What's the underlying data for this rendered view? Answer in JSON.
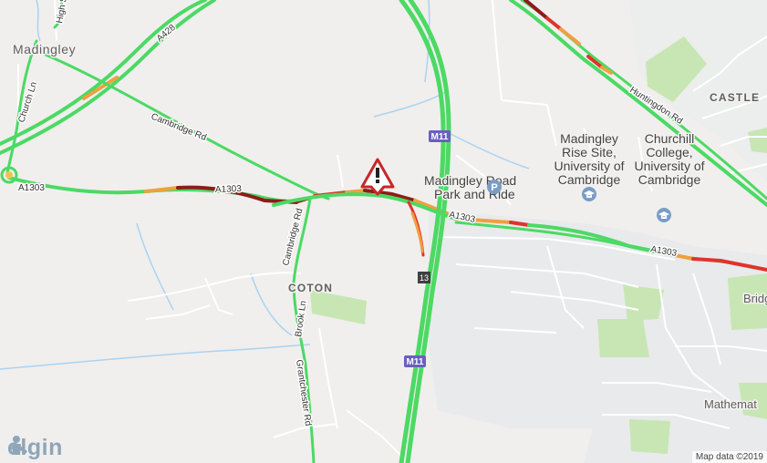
{
  "map": {
    "roads": {
      "m11_top": "M11",
      "m11_bottom": "M11",
      "junction": "13",
      "a1303_left": "A1303",
      "a1303_mid": "A1303",
      "a1303_right_1": "A1303",
      "a1303_right_2": "A1303",
      "a428": "A428",
      "cambridge_rd_1": "Cambridge Rd",
      "cambridge_rd_2": "Cambridge Rd",
      "huntingdon_rd": "Huntingdon Rd",
      "church_ln": "Church Ln",
      "high_st": "High St",
      "brook_ln": "Brook Ln",
      "grantchester_rd": "Grantchester Rd"
    },
    "places": {
      "madingley": "Madingley",
      "coton": "COTON",
      "castle": "CASTLE",
      "bridge_partial": "Bridg",
      "mathematics_partial": "Mathemat"
    },
    "pois": {
      "park_and_ride": [
        "Madingley Road",
        "Park and Ride"
      ],
      "madingley_rise": [
        "Madingley",
        "Rise Site,",
        "University of",
        "Cambridge"
      ],
      "churchill": [
        "Churchill",
        "College,",
        "University of",
        "Cambridge"
      ]
    },
    "attribution": "Map data ©2019",
    "brand": "elgin",
    "traffic_colors": {
      "free_flow": "#4cd964",
      "slow": "#f0a040",
      "congested": "#e0332b",
      "severe": "#8e1b1b"
    },
    "icons": {
      "incident": "warning-triangle-icon",
      "parking": "parking-icon",
      "university_a": "graduation-cap-icon",
      "university_b": "graduation-cap-icon",
      "brand": "workman-icon"
    }
  }
}
